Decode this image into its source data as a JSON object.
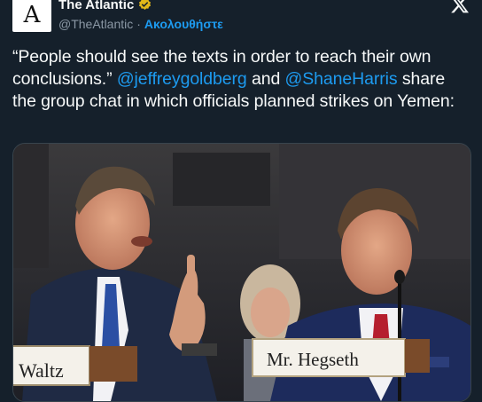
{
  "header": {
    "avatar_letter": "A",
    "account_name": "The Atlantic",
    "handle": "@TheAtlantic",
    "separator": "·",
    "follow_label": "Ακολουθήστε",
    "verified_color": "#e2b719"
  },
  "tweet": {
    "text_part1": "“People should see the texts in order to reach their own conclusions.” ",
    "mention1": "@jeffreygoldberg",
    "text_part2": " and ",
    "mention2": "@ShaneHarris",
    "text_part3": " share the group chat in which officials planned strikes on Yemen:"
  },
  "media": {
    "placard_left": "Waltz",
    "placard_right": "Mr. Hegseth"
  },
  "colors": {
    "background": "#15202b",
    "link": "#1d9bf0",
    "secondary_text": "#8b98a5"
  }
}
